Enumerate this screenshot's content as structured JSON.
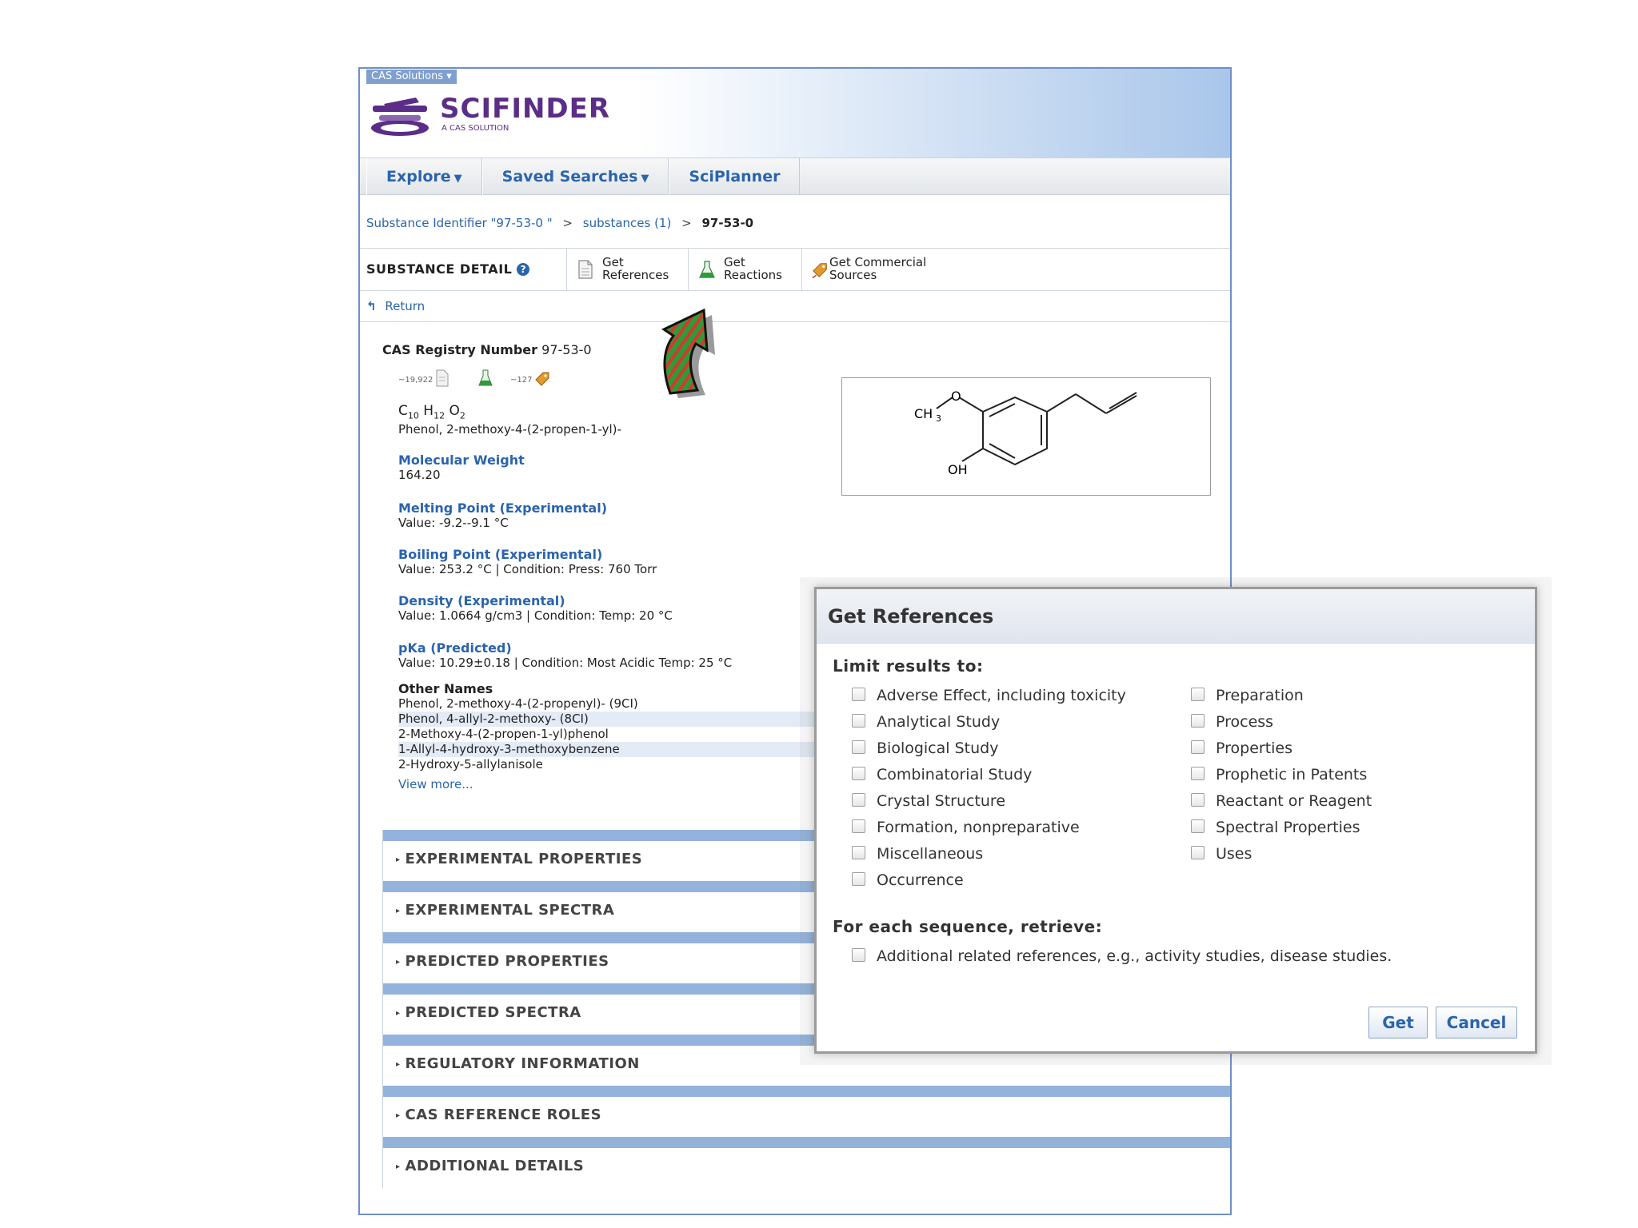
{
  "header": {
    "cas_solutions": "CAS Solutions",
    "logo_text": "SCIFINDER",
    "logo_sub": "A CAS SOLUTION"
  },
  "nav": {
    "explore": "Explore",
    "saved_searches": "Saved Searches",
    "sciplanner": "SciPlanner"
  },
  "breadcrumb": {
    "item1": "Substance Identifier \"97-53-0 \"",
    "item2": "substances (1)",
    "current": "97-53-0",
    "sep": ">"
  },
  "toolbar": {
    "title": "SUBSTANCE DETAIL",
    "help": "?",
    "get_references": [
      "Get",
      "References"
    ],
    "get_reactions": [
      "Get",
      "Reactions"
    ],
    "get_commercial": [
      "Get Commercial",
      "Sources"
    ]
  },
  "return_label": "Return",
  "substance": {
    "cas_rn_label": "CAS Registry Number",
    "cas_rn": "97-53-0",
    "ref_count": "~19,922",
    "supplier_count": "~127",
    "formula": {
      "C": "C",
      "c_n": "10",
      "H": "H",
      "h_n": "12",
      "O": "O",
      "o_n": "2"
    },
    "index_name": "Phenol, 2-methoxy-4-(2-propen-1-yl)-",
    "properties": [
      {
        "title": "Molecular Weight",
        "value": "164.20"
      },
      {
        "title": "Melting Point (Experimental)",
        "value": "Value: -9.2--9.1 °C"
      },
      {
        "title": "Boiling Point (Experimental)",
        "value": "Value: 253.2 °C | Condition: Press: 760 Torr"
      },
      {
        "title": "Density (Experimental)",
        "value": "Value: 1.0664 g/cm3 | Condition: Temp: 20 °C"
      },
      {
        "title": "pKa (Predicted)",
        "value": "Value: 10.29±0.18 | Condition: Most Acidic Temp: 25 °C"
      }
    ],
    "other_names_title": "Other Names",
    "other_names": [
      "Phenol, 2-methoxy-4-(2-propenyl)- (9CI)",
      "Phenol, 4-allyl-2-methoxy- (8CI)",
      "2-Methoxy-4-(2-propen-1-yl)phenol",
      "1-Allyl-4-hydroxy-3-methoxybenzene",
      "2-Hydroxy-5-allylanisole"
    ],
    "view_more": "View more...",
    "structure_labels": {
      "o": "O",
      "ch": "CH",
      "ch_sub": "3",
      "oh": "OH"
    }
  },
  "sections": [
    "EXPERIMENTAL PROPERTIES",
    "EXPERIMENTAL SPECTRA",
    "PREDICTED PROPERTIES",
    "PREDICTED SPECTRA",
    "REGULATORY INFORMATION",
    "CAS REFERENCE ROLES",
    "ADDITIONAL DETAILS"
  ],
  "dialog": {
    "title": "Get References",
    "limit_label": "Limit results to:",
    "left_options": [
      "Adverse Effect, including toxicity",
      "Analytical Study",
      "Biological Study",
      "Combinatorial Study",
      "Crystal Structure",
      "Formation, nonpreparative",
      "Miscellaneous",
      "Occurrence"
    ],
    "right_options": [
      "Preparation",
      "Process",
      "Properties",
      "Prophetic in Patents",
      "Reactant or Reagent",
      "Spectral Properties",
      "Uses"
    ],
    "sequence_label": "For each sequence, retrieve:",
    "sequence_option": "Additional related references, e.g., activity studies, disease studies.",
    "get_button": "Get",
    "cancel_button": "Cancel"
  },
  "colors": {
    "link_blue": "#2a64ad",
    "brand_purple": "#5b2d86",
    "section_bar": "#94b3dc"
  }
}
